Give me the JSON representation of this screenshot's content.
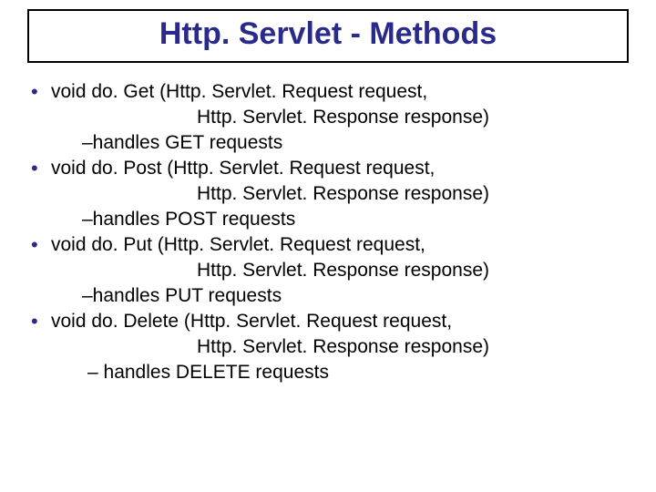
{
  "title": "Http. Servlet - Methods",
  "methods": [
    {
      "sig": "void do. Get (Http. Servlet. Request request,",
      "cont": "Http. Servlet. Response response)",
      "note": "–handles GET requests",
      "noteClass": "note"
    },
    {
      "sig": "void do. Post (Http. Servlet. Request request,",
      "cont": "Http. Servlet. Response response)",
      "note": "–handles POST requests",
      "noteClass": "note"
    },
    {
      "sig": "void do. Put (Http. Servlet. Request request,",
      "cont": "Http. Servlet. Response response)",
      "note": "–handles PUT requests",
      "noteClass": "note"
    },
    {
      "sig": "void do. Delete (Http. Servlet. Request request,",
      "cont": "Http. Servlet. Response response)",
      "note": "– handles DELETE requests",
      "noteClass": "note2"
    }
  ]
}
